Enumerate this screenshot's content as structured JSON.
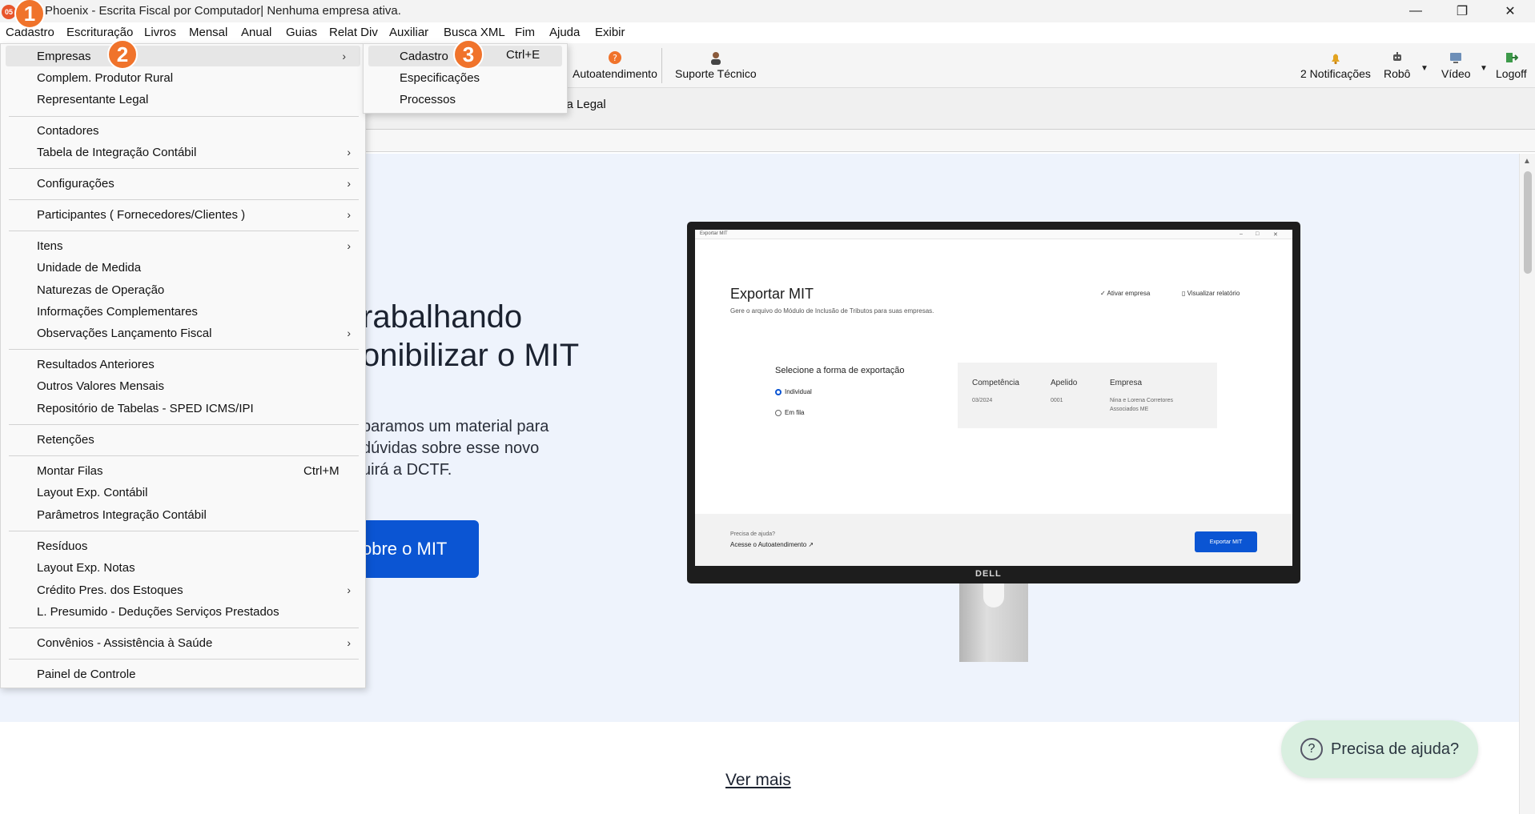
{
  "window": {
    "title": "Phoenix - Escrita Fiscal por Computador| Nenhuma empresa ativa.",
    "icon_label": "05",
    "controls": {
      "minimize": "—",
      "restore": "❐",
      "close": "✕"
    }
  },
  "menubar": [
    "Cadastro",
    "Escrituração",
    "Livros",
    "Mensal",
    "Anual",
    "Guias",
    "Relat Div",
    "Auxiliar",
    "Busca XML",
    "Fim",
    "Ajuda",
    "Exibir"
  ],
  "toolbar": {
    "autoatendimento": "Autoatendimento",
    "suporte": "Suporte Técnico",
    "notificacoes": "2 Notificações",
    "robo": "Robô",
    "video": "Vídeo",
    "logoff": "Logoff"
  },
  "subbar": {
    "text": "ca Legal"
  },
  "cadastro_menu": {
    "items": [
      {
        "label": "Empresas",
        "arrow": true
      },
      {
        "label": "Complem. Produtor Rural"
      },
      {
        "label": "Representante Legal"
      },
      {
        "label": "Contadores"
      },
      {
        "label": "Tabela de Integração Contábil",
        "arrow": true
      },
      {
        "label": "Configurações",
        "arrow": true
      },
      {
        "label": "Participantes ( Fornecedores/Clientes )",
        "arrow": true
      },
      {
        "label": "Itens",
        "arrow": true
      },
      {
        "label": "Unidade de Medida"
      },
      {
        "label": "Naturezas de Operação"
      },
      {
        "label": "Informações Complementares"
      },
      {
        "label": "Observações Lançamento Fiscal",
        "arrow": true
      },
      {
        "label": "Resultados Anteriores"
      },
      {
        "label": "Outros Valores Mensais"
      },
      {
        "label": "Repositório de Tabelas - SPED ICMS/IPI"
      },
      {
        "label": "Retenções"
      },
      {
        "label": "Montar Filas",
        "shortcut": "Ctrl+M"
      },
      {
        "label": "Layout Exp. Contábil"
      },
      {
        "label": "Parâmetros Integração Contábil"
      },
      {
        "label": "Resíduos"
      },
      {
        "label": "Layout Exp. Notas"
      },
      {
        "label": "Crédito Pres. dos Estoques",
        "arrow": true
      },
      {
        "label": "L. Presumido - Deduções Serviços Prestados"
      },
      {
        "label": "Convênios - Assistência à Saúde",
        "arrow": true
      },
      {
        "label": "Painel de Controle"
      }
    ],
    "arrow_glyph": "›"
  },
  "empresas_submenu": {
    "items": [
      {
        "label": "Cadastro",
        "shortcut": "Ctrl+E"
      },
      {
        "label": "Especificações"
      },
      {
        "label": "Processos"
      }
    ]
  },
  "badges": [
    "1",
    "2",
    "3"
  ],
  "hero": {
    "heading_line1": "rabalhando",
    "heading_line2": "onibilizar o MIT",
    "para_line1": "paramos um material para",
    "para_line2": "dúvidas sobre esse novo",
    "para_line3": "uirá a DCTF.",
    "button": "obre o MIT"
  },
  "monitor": {
    "window_title": "Exportar MIT",
    "title": "Exportar MIT",
    "subtitle": "Gere o arquivo do Módulo de Inclusão de Tributos para suas empresas.",
    "link_activate": "✓  Ativar empresa",
    "link_report": "▯  Visualizar relatório",
    "choose": "Selecione a forma de exportação",
    "radio_individual": "Individual",
    "radio_fila": "Em fila",
    "table_headers": [
      "Competência",
      "Apelido",
      "Empresa"
    ],
    "row": {
      "competencia": "03/2024",
      "apelido": "0001",
      "empresa_l1": "Nina e Lorena Corretores",
      "empresa_l2": "Associados ME"
    },
    "help_q": "Precisa de ajuda?",
    "help_link": "Acesse o Autoatendimento  ↗",
    "export_btn": "Exportar MIT",
    "brand": "DELL"
  },
  "ver_mais": "Ver mais",
  "help_bubble": {
    "icon": "?",
    "text": "Precisa de ajuda?"
  }
}
